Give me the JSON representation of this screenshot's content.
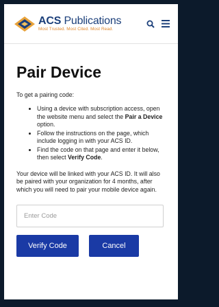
{
  "header": {
    "logo_name_bold": "ACS",
    "logo_name_rest": "Publications",
    "logo_tagline": "Most Trusted. Most Cited. Most Read.",
    "icons": [
      "search-icon",
      "menu-icon"
    ]
  },
  "main": {
    "title": "Pair Device",
    "intro": "To get a pairing code:",
    "steps": [
      {
        "pre": "Using a device with subscription access, open the website menu and select the ",
        "bold": "Pair a Device",
        "post": " option."
      },
      {
        "pre": "Follow the instructions on the page, which include logging in with your ACS ID.",
        "bold": "",
        "post": ""
      },
      {
        "pre": "Find the code on that page and enter it below, then select ",
        "bold": "Verify Code",
        "post": "."
      }
    ],
    "info": "Your device will be linked with your ACS ID. It will also be paired with your organization for 4 months, after which you will need to pair your mobile device again.",
    "code_placeholder": "Enter Code",
    "verify_label": "Verify Code",
    "cancel_label": "Cancel"
  },
  "colors": {
    "brand_blue": "#1b3f7a",
    "button_blue": "#1a3aa5",
    "tagline_orange": "#e0862a",
    "page_background": "#0c1a2b"
  }
}
